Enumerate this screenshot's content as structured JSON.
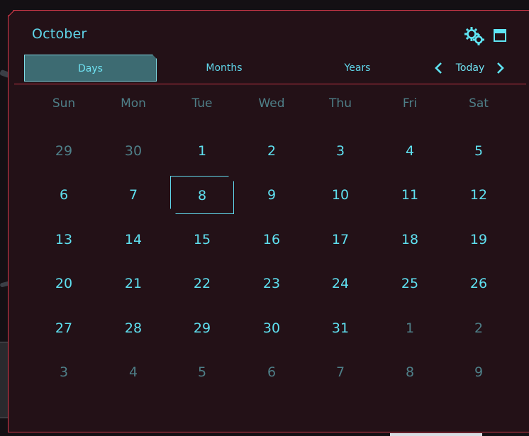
{
  "calendar": {
    "title": "October",
    "tabs": [
      "Days",
      "Months",
      "Years"
    ],
    "active_tab": "Days",
    "nav": {
      "today_label": "Today",
      "prev_icon": "chevron-left-icon",
      "next_icon": "chevron-right-icon"
    },
    "header_icons": [
      "gear-icon",
      "window-icon"
    ],
    "weekdays": [
      "Sun",
      "Mon",
      "Tue",
      "Wed",
      "Thu",
      "Fri",
      "Sat"
    ],
    "weeks": [
      [
        {
          "d": "29",
          "muted": true
        },
        {
          "d": "30",
          "muted": true
        },
        {
          "d": "1"
        },
        {
          "d": "2"
        },
        {
          "d": "3"
        },
        {
          "d": "4"
        },
        {
          "d": "5"
        }
      ],
      [
        {
          "d": "6"
        },
        {
          "d": "7"
        },
        {
          "d": "8",
          "selected": true
        },
        {
          "d": "9"
        },
        {
          "d": "10"
        },
        {
          "d": "11"
        },
        {
          "d": "12"
        }
      ],
      [
        {
          "d": "13"
        },
        {
          "d": "14"
        },
        {
          "d": "15"
        },
        {
          "d": "16"
        },
        {
          "d": "17"
        },
        {
          "d": "18"
        },
        {
          "d": "19"
        }
      ],
      [
        {
          "d": "20"
        },
        {
          "d": "21"
        },
        {
          "d": "22"
        },
        {
          "d": "23"
        },
        {
          "d": "24"
        },
        {
          "d": "25"
        },
        {
          "d": "26"
        }
      ],
      [
        {
          "d": "27"
        },
        {
          "d": "28"
        },
        {
          "d": "29"
        },
        {
          "d": "30"
        },
        {
          "d": "31"
        },
        {
          "d": "1",
          "muted": true
        },
        {
          "d": "2",
          "muted": true
        }
      ],
      [
        {
          "d": "3",
          "muted": true
        },
        {
          "d": "4",
          "muted": true
        },
        {
          "d": "5",
          "muted": true
        },
        {
          "d": "6",
          "muted": true
        },
        {
          "d": "7",
          "muted": true
        },
        {
          "d": "8",
          "muted": true
        },
        {
          "d": "9",
          "muted": true
        }
      ]
    ],
    "colors": {
      "accent": "#5fd4e8",
      "muted": "#4e7f88",
      "border": "#d83a4c",
      "panel": "#231117",
      "active_tab": "#3d6b72"
    }
  }
}
